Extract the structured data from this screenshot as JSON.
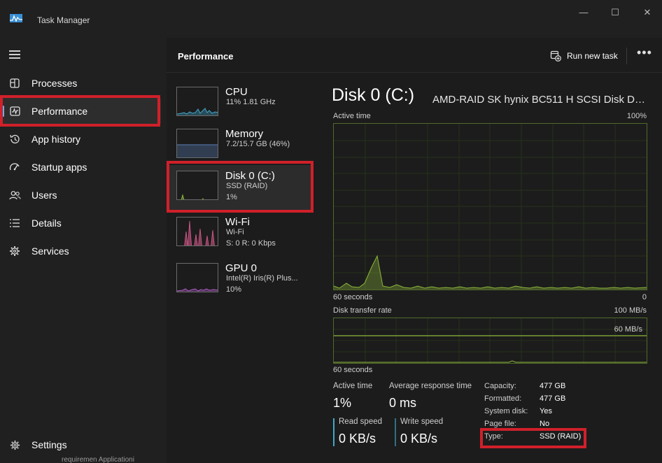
{
  "window": {
    "title": "Task Manager",
    "controls": {
      "minimize": "—",
      "maximize": "☐",
      "close": "✕"
    }
  },
  "sidebar": {
    "items": [
      {
        "label": "Processes",
        "icon": "processes-icon"
      },
      {
        "label": "Performance",
        "icon": "performance-icon",
        "active": true
      },
      {
        "label": "App history",
        "icon": "history-icon"
      },
      {
        "label": "Startup apps",
        "icon": "startup-icon"
      },
      {
        "label": "Users",
        "icon": "users-icon"
      },
      {
        "label": "Details",
        "icon": "details-icon"
      },
      {
        "label": "Services",
        "icon": "services-icon"
      }
    ],
    "settings": "Settings"
  },
  "header": {
    "title": "Performance",
    "run_new_task": "Run new task",
    "more": "•••"
  },
  "devices": [
    {
      "name": "CPU",
      "line1": "11%  1.81 GHz",
      "line2": ""
    },
    {
      "name": "Memory",
      "line1": "7.2/15.7 GB (46%)",
      "line2": ""
    },
    {
      "name": "Disk 0 (C:)",
      "line1": "SSD (RAID)",
      "line2": "1%"
    },
    {
      "name": "Wi-Fi",
      "line1": "Wi-Fi",
      "line2": "S: 0  R: 0 Kbps"
    },
    {
      "name": "GPU 0",
      "line1": "Intel(R) Iris(R) Plus...",
      "line2": "10%"
    }
  ],
  "detail": {
    "title": "Disk 0 (C:)",
    "model": "AMD-RAID SK hynix BC511 H SCSI Disk Device",
    "graph1": {
      "label": "Active time",
      "max": "100%",
      "time": "60 seconds",
      "min": "0"
    },
    "graph2": {
      "label": "Disk transfer rate",
      "max": "100 MB/s",
      "mid": "60 MB/s",
      "time": "60 seconds"
    },
    "stats": {
      "active_time_label": "Active time",
      "active_time_value": "1%",
      "avg_response_label": "Average response time",
      "avg_response_value": "0 ms",
      "read_speed_label": "Read speed",
      "read_speed_value": "0 KB/s",
      "write_speed_label": "Write speed",
      "write_speed_value": "0 KB/s"
    },
    "properties": [
      {
        "key": "Capacity:",
        "value": "477 GB"
      },
      {
        "key": "Formatted:",
        "value": "477 GB"
      },
      {
        "key": "System disk:",
        "value": "Yes"
      },
      {
        "key": "Page file:",
        "value": "No"
      },
      {
        "key": "Type:",
        "value": "SSD (RAID)"
      }
    ]
  },
  "colors": {
    "accent": "#5eb4e8",
    "highlight": "#d0202a",
    "disk_graph": "#8cb83a",
    "cpu_graph": "#41a7c8",
    "memory_graph": "#5a7fb8",
    "wifi_graph": "#d85a8c",
    "gpu_graph": "#b05cc8"
  },
  "behind_window_text": "requiremen   Applicationi"
}
